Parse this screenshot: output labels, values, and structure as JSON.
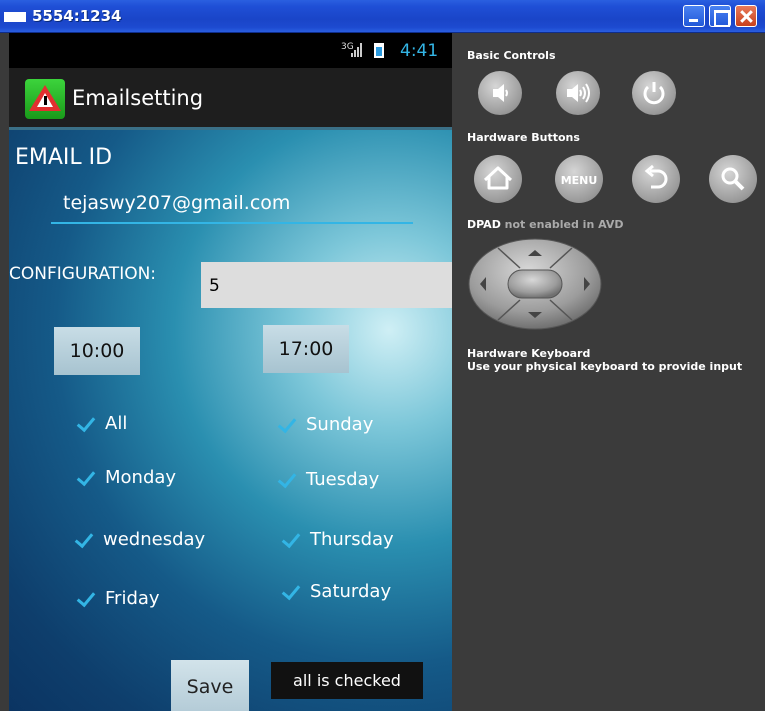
{
  "window": {
    "title": "5554:1234"
  },
  "statusbar": {
    "network": "3G",
    "time": "4:41"
  },
  "actionbar": {
    "title": "Emailsetting",
    "icon": "warning-app-icon"
  },
  "form": {
    "email_label": "EMAIL ID",
    "email_value": "tejaswy207@gmail.com",
    "config_label": "CONFIGURATION:",
    "config_value": "5",
    "start_time": "10:00",
    "end_time": "17:00",
    "days": [
      {
        "label": "All",
        "checked": true
      },
      {
        "label": "Sunday",
        "checked": true
      },
      {
        "label": "Monday",
        "checked": true
      },
      {
        "label": "Tuesday",
        "checked": true
      },
      {
        "label": "wednesday",
        "checked": true
      },
      {
        "label": "Thursday",
        "checked": true
      },
      {
        "label": "Friday",
        "checked": true
      },
      {
        "label": "Saturday",
        "checked": true
      }
    ],
    "save_label": "Save",
    "toast": "all is checked"
  },
  "controls": {
    "basic_label": "Basic Controls",
    "hardware_label": "Hardware Buttons",
    "dpad_label": "DPAD",
    "dpad_note": "not enabled in AVD",
    "keyboard_label": "Hardware Keyboard",
    "keyboard_note": "Use your physical keyboard to provide input",
    "menu_label": "MENU"
  },
  "colors": {
    "accent": "#33b5e5",
    "titlebar": "#1f4fd6"
  }
}
